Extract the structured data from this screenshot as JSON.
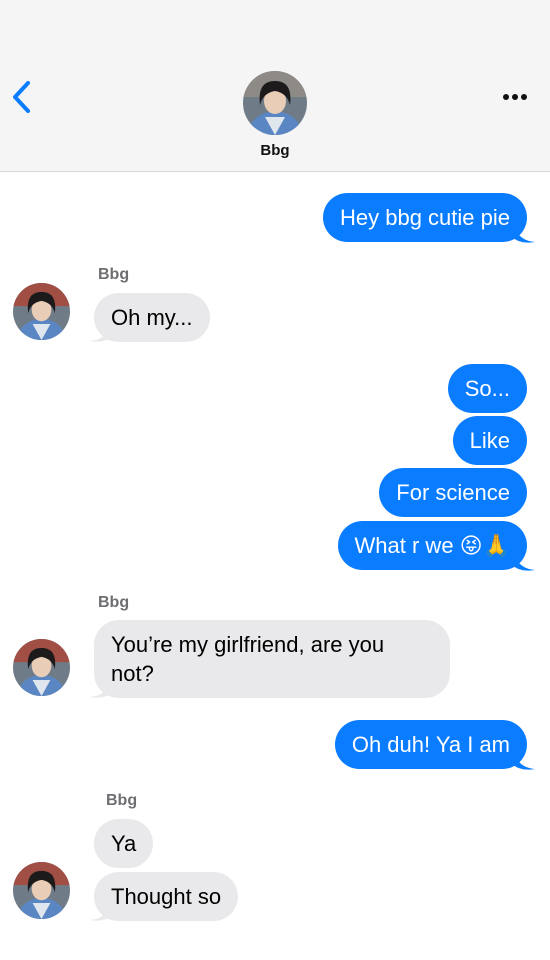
{
  "contact": {
    "name": "Bbg"
  },
  "colors": {
    "sent_bubble": "#0a7cff",
    "received_bubble": "#e9e9eb",
    "accent": "#0a7cff",
    "header_bg": "#f5f5f5"
  },
  "header": {
    "back_icon": "chevron-left-icon",
    "menu_icon": "more-dots-icon"
  },
  "messages": [
    {
      "direction": "sent",
      "text": "Hey bbg cutie pie"
    },
    {
      "direction": "received",
      "sender": "Bbg",
      "text": "Oh my..."
    },
    {
      "direction": "sent",
      "text": "So..."
    },
    {
      "direction": "sent",
      "text": "Like"
    },
    {
      "direction": "sent",
      "text": "For science"
    },
    {
      "direction": "sent",
      "text": "What r we 😝🙏"
    },
    {
      "direction": "received",
      "sender": "Bbg",
      "text": "You’re my girlfriend, are you not?"
    },
    {
      "direction": "sent",
      "text": "Oh duh! Ya I am"
    },
    {
      "direction": "received",
      "sender": "Bbg",
      "text": "Ya"
    },
    {
      "direction": "received",
      "text": "Thought so"
    }
  ]
}
